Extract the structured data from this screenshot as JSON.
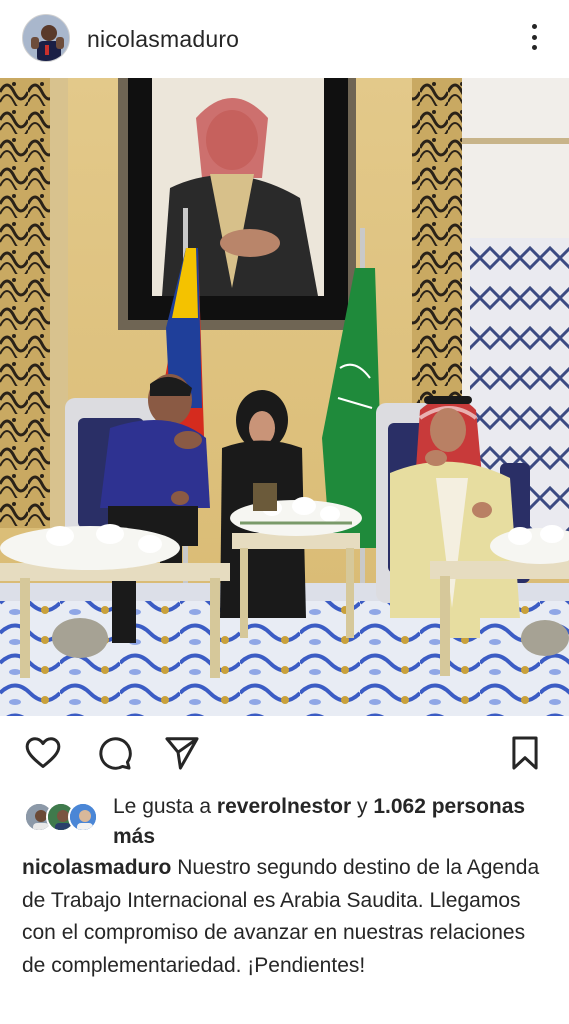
{
  "post": {
    "username": "nicolasmaduro",
    "more_icon": "more-vertical-icon"
  },
  "actions": {
    "like_icon": "heart-icon",
    "comment_icon": "comment-icon",
    "share_icon": "send-icon",
    "save_icon": "bookmark-icon"
  },
  "likes": {
    "prefix": "Le gusta a ",
    "user": "reverolnestor",
    "connector": " y ",
    "count": "1.062",
    "suffix": " personas más"
  },
  "caption": {
    "user": "nicolasmaduro",
    "text": " Nuestro segundo destino de la Agenda de Trabajo Internacional es Arabia Saudita. Llegamos con el compromiso de avanzar en nuestras relaciones de complementariedad. ¡Pendientes!"
  },
  "colors": {
    "text": "#262626",
    "background": "#ffffff",
    "venezuela_yellow": "#f4c200",
    "venezuela_blue": "#1f3f9a",
    "venezuela_red": "#d52b1e",
    "saudi_green": "#1f8a3b"
  }
}
